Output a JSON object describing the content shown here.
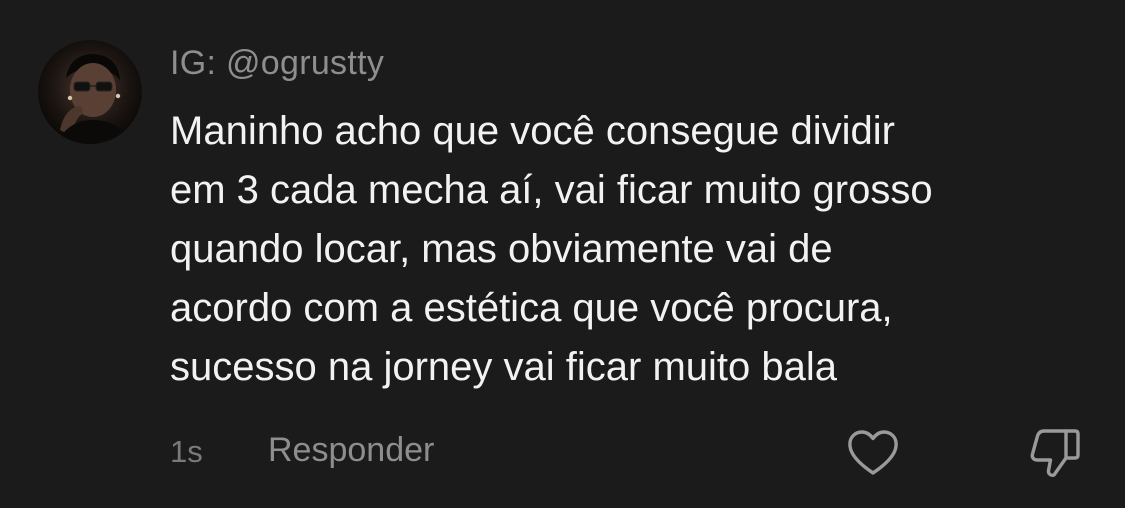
{
  "comment": {
    "username": "IG: @ogrustty",
    "text_lines": [
      "Maninho acho que você consegue dividir",
      "em 3 cada mecha aí, vai ficar muito grosso",
      "quando locar, mas obviamente vai de",
      "acordo com a estética que você procura,",
      "sucesso na jorney vai ficar muito bala"
    ],
    "timestamp": "1s",
    "reply_label": "Responder",
    "icons": {
      "avatar": "avatar",
      "like": "heart-icon",
      "dislike": "thumbs-down-icon"
    }
  },
  "colors": {
    "background": "#1b1b1b",
    "text": "#f2f2f2",
    "muted": "#8e8e8e"
  }
}
